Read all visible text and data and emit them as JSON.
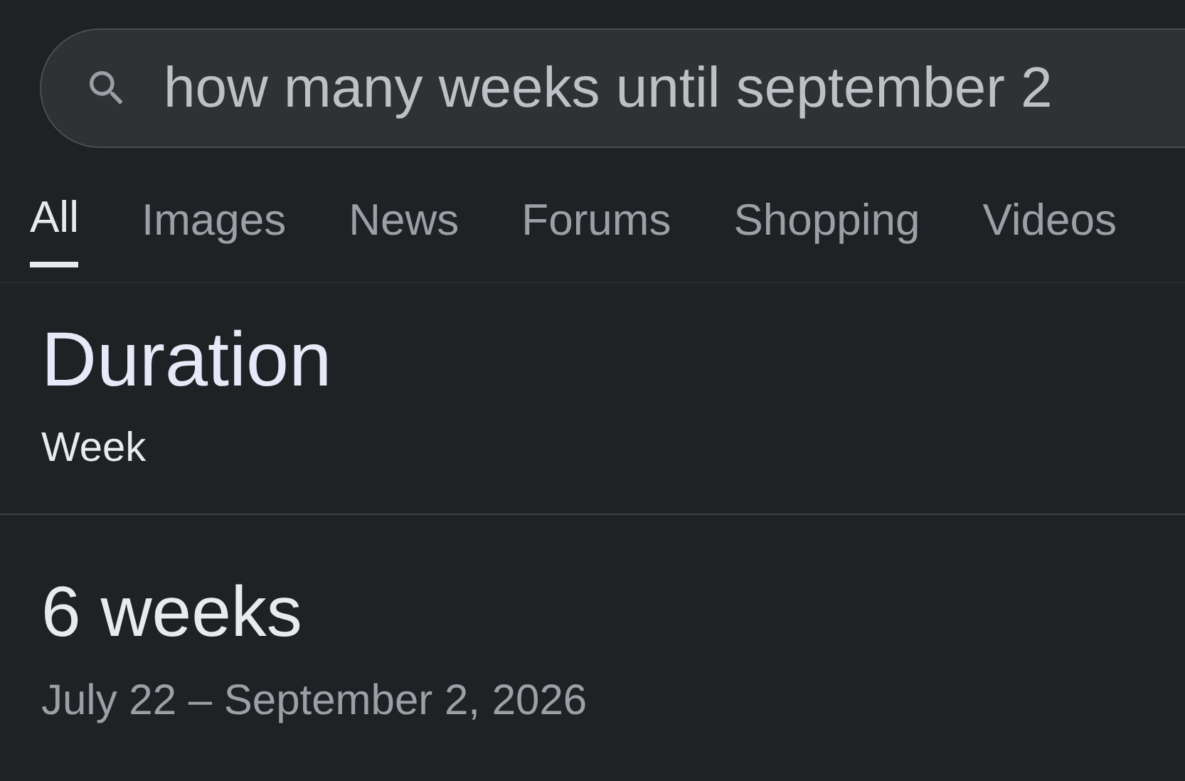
{
  "search": {
    "value": "how many weeks until september 2"
  },
  "tabs": [
    {
      "label": "All",
      "selected": true
    },
    {
      "label": "Images",
      "selected": false
    },
    {
      "label": "News",
      "selected": false
    },
    {
      "label": "Forums",
      "selected": false
    },
    {
      "label": "Shopping",
      "selected": false
    },
    {
      "label": "Videos",
      "selected": false
    }
  ],
  "card": {
    "title": "Duration",
    "unit": "Week",
    "result": "6 weeks",
    "range": "July 22 – September 2, 2026"
  }
}
